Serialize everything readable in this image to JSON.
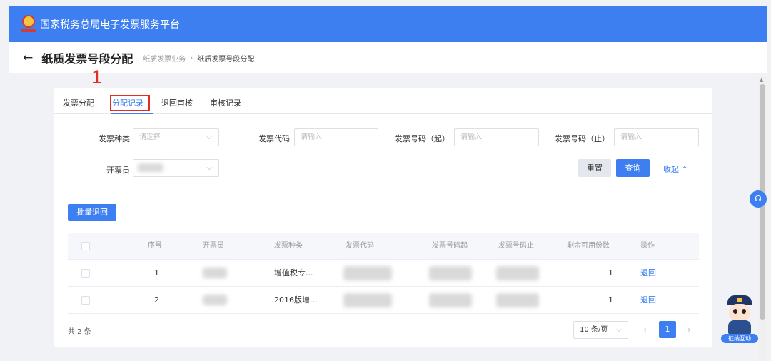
{
  "header": {
    "app_title": "国家税务总局电子发票服务平台"
  },
  "subheader": {
    "page_title": "纸质发票号段分配",
    "breadcrumb": [
      "纸质发票业务",
      "纸质发票号段分配"
    ],
    "breadcrumb_separator": "›"
  },
  "annotation": {
    "marker": "1"
  },
  "tabs": [
    {
      "label": "发票分配",
      "active": false
    },
    {
      "label": "分配记录",
      "active": true
    },
    {
      "label": "退回审核",
      "active": false
    },
    {
      "label": "审核记录",
      "active": false
    }
  ],
  "filters": {
    "invoice_type": {
      "label": "发票种类",
      "placeholder": "请选择"
    },
    "invoice_code": {
      "label": "发票代码",
      "placeholder": "请输入"
    },
    "invoice_no_start": {
      "label": "发票号码（起）",
      "placeholder": "请输入"
    },
    "invoice_no_end": {
      "label": "发票号码（止）",
      "placeholder": "请输入"
    },
    "issuer": {
      "label": "开票员"
    }
  },
  "actions": {
    "reset": "重置",
    "query": "查询",
    "collapse": "收起",
    "batch_return": "批量退回"
  },
  "table": {
    "columns": [
      "序号",
      "开票员",
      "发票种类",
      "发票代码",
      "发票号码起",
      "发票号码止",
      "剩余可用份数",
      "操作"
    ],
    "rows": [
      {
        "index": "1",
        "invoice_type": "增值税专...",
        "remaining": "1",
        "action": "退回"
      },
      {
        "index": "2",
        "invoice_type": "2016版增...",
        "remaining": "1",
        "action": "退回"
      }
    ]
  },
  "pagination": {
    "total": "共 2 条",
    "page_size": "10 条/页",
    "current_page": "1"
  },
  "mascot": {
    "label": "征纳互动"
  },
  "icons": {
    "back": "arrow-left-icon",
    "chevron": "chevron-down-icon",
    "collapse": "chevron-up-icon",
    "help": "headset-icon"
  },
  "colors": {
    "primary": "#3d7ff0",
    "annotation": "#e02e24"
  }
}
